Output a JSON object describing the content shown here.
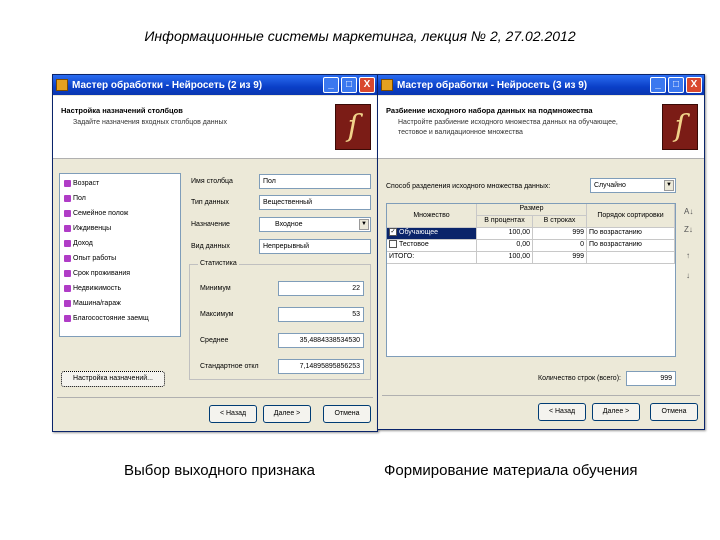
{
  "slide": {
    "title": "Информационные системы маркетинга, лекция № 2, 27.02.2012",
    "caption_left": "Выбор выходного признака",
    "caption_right": "Формирование материала обучения"
  },
  "window_left": {
    "title": "Мастер обработки - Нейросеть (2 из 9)",
    "header_title": "Настройка назначений столбцов",
    "header_subtitle": "Задайте назначения входных столбцов данных",
    "columns": [
      "Возраст",
      "Пол",
      "Семейное полож",
      "Иждивенцы",
      "Доход",
      "Опыт работы",
      "Срок проживания",
      "Недвижимость",
      "Машина/гараж",
      "Благосостояние заемщ"
    ],
    "name_label": "Имя столбца",
    "name_value": "Пол",
    "type_label": "Тип данных",
    "type_value": "Вещественный",
    "purpose_label": "Назначение",
    "purpose_value": "Входное",
    "kind_label": "Вид данных",
    "kind_value": "Непрерывный",
    "group_title": "Статистика",
    "min_label": "Минимум",
    "min_value": "22",
    "max_label": "Максимум",
    "max_value": "53",
    "mean_label": "Среднее",
    "mean_value": "35,4884338534530",
    "std_label": "Стандартное откл",
    "std_value": "7,14895895856253",
    "settings_button": "Настройка назначений...",
    "back_button": "< Назад",
    "next_button": "Далее >",
    "cancel_button": "Отмена"
  },
  "window_right": {
    "title": "Мастер обработки - Нейросеть (3 из 9)",
    "header_title": "Разбиение исходного набора данных на подмножества",
    "header_subtitle": "Настройте разбиение исходного множества данных на обучающее, тестовое и валидационное множества",
    "method_label": "Способ разделения исходного множества данных:",
    "method_value": "Случайно",
    "table": {
      "col_set": "Множество",
      "col_size": "Размер",
      "col_percent": "В процентах",
      "col_records": "В строках",
      "col_order": "Порядок сортировки",
      "rows": [
        {
          "name": "Обучающее",
          "checked": true,
          "percent": "100,00",
          "records": "999",
          "order": "По возрастанию"
        },
        {
          "name": "Тестовое",
          "checked": false,
          "percent": "0,00",
          "records": "0",
          "order": "По возрастанию"
        },
        {
          "name": "ИТОГО:",
          "checked": null,
          "percent": "100,00",
          "records": "999",
          "order": ""
        }
      ]
    },
    "count_label": "Количество строк (всего):",
    "count_value": "999",
    "back_button": "< Назад",
    "next_button": "Далее >",
    "cancel_button": "Отмена"
  }
}
